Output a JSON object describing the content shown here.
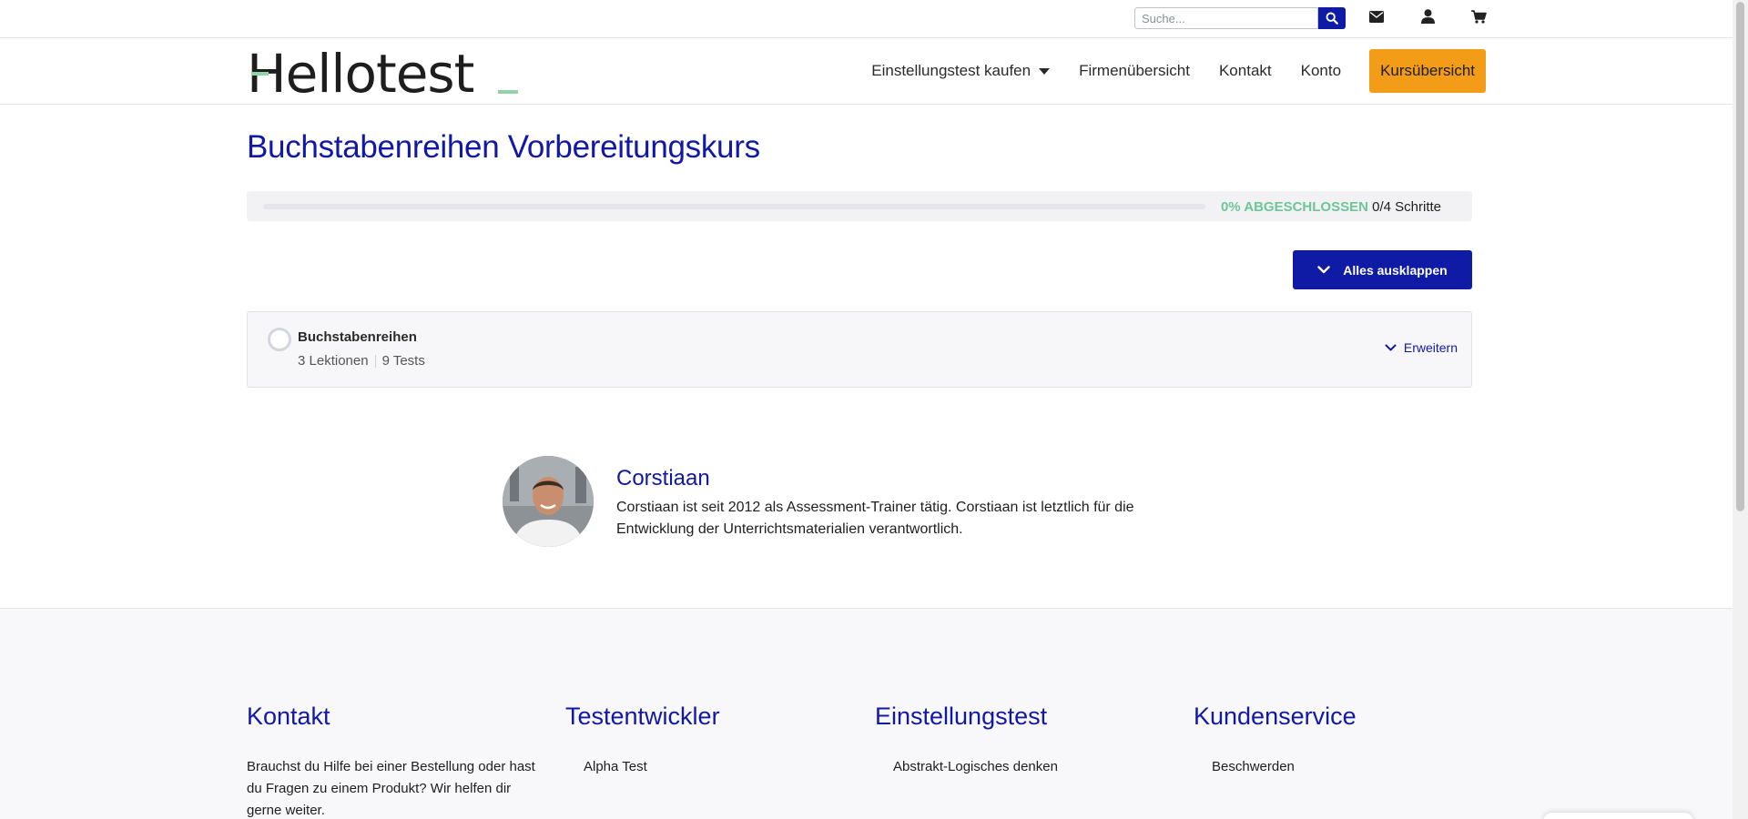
{
  "topbar": {
    "search_placeholder": "Suche...",
    "icons": [
      "search-icon",
      "envelope-icon",
      "user-icon",
      "cart-icon"
    ]
  },
  "header": {
    "logo_text": "Hellotest",
    "nav": {
      "item1": "Einstellungstest kaufen",
      "item2": "Firmenübersicht",
      "item3": "Kontakt",
      "item4": "Konto",
      "cta": "Kursübersicht"
    }
  },
  "course": {
    "title": "Buchstabenreihen Vorbereitungskurs",
    "progress_percent": 0,
    "progress_label": "0% ABGESCHLOSSEN",
    "steps_label": "0/4 Schritte",
    "expand_all_label": "Alles ausklappen",
    "section": {
      "title": "Buchstabenreihen",
      "lessons": "3 Lektionen",
      "tests": "9 Tests",
      "expand_label": "Erweitern"
    }
  },
  "author": {
    "name": "Corstiaan",
    "bio": "Corstiaan ist seit 2012 als Assessment-Trainer tätig. Corstiaan ist letztlich für die Entwicklung der Unterrichtsmaterialien verantwortlich."
  },
  "footer": {
    "contact": {
      "heading": "Kontakt",
      "text": "Brauchst du Hilfe bei einer Bestellung oder hast du Fragen zu einem Produkt? Wir helfen dir gerne weiter."
    },
    "developer": {
      "heading": "Testentwickler",
      "link1": "Alpha Test"
    },
    "tests": {
      "heading": "Einstellungstest",
      "link1": "Abstrakt-Logisches denken"
    },
    "service": {
      "heading": "Kundenservice",
      "link1": "Beschwerden"
    }
  },
  "colors": {
    "brand_blue": "#1218a6",
    "button_blue": "#0f1aa5",
    "cta_orange": "#f39c17",
    "progress_green": "#6dc698",
    "logo_accent_green": "#8fd3a6"
  }
}
